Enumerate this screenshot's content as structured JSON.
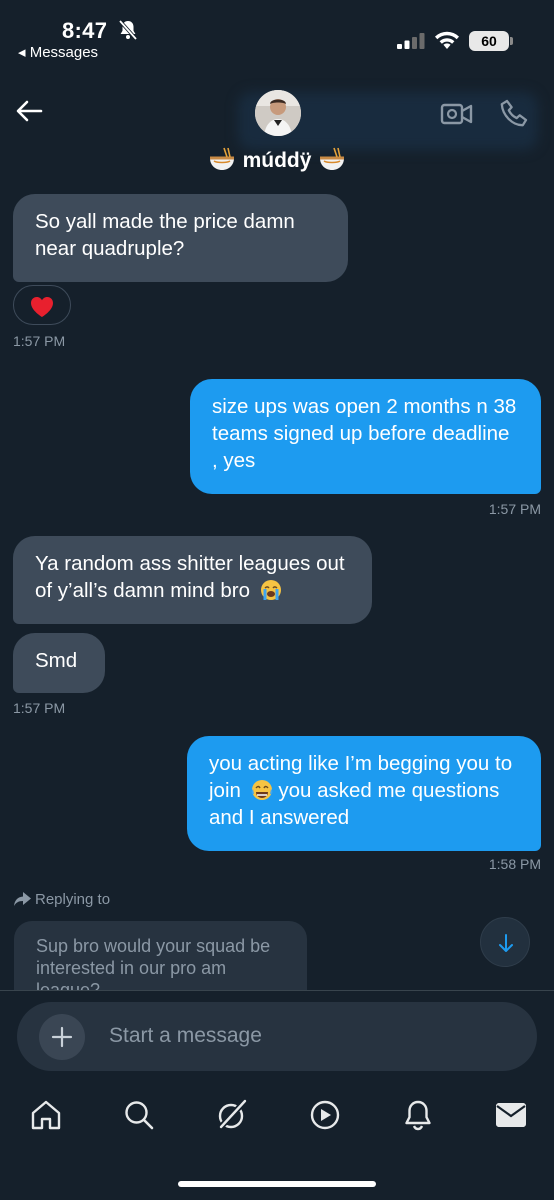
{
  "status_bar": {
    "time": "8:47",
    "back_app": "◂ Messages",
    "battery": "60"
  },
  "header": {
    "contact_name": "múddÿ"
  },
  "messages": [
    {
      "text": "So yall made the price damn near quadruple?",
      "direction": "incoming",
      "reaction": "red-heart"
    },
    {
      "text": "1:57 PM",
      "kind": "timestamp"
    },
    {
      "text": "size ups was open 2 months n 38 teams signed up before deadline , yes",
      "direction": "outgoing"
    },
    {
      "text": "1:57 PM",
      "kind": "timestamp"
    },
    {
      "text": "Ya random ass shitter leagues out of y’all’s damn mind bro",
      "direction": "incoming",
      "emoji": "loudly-crying-face"
    },
    {
      "text": "Smd",
      "direction": "incoming"
    },
    {
      "text": "1:57 PM",
      "kind": "timestamp"
    },
    {
      "text": "you acting like I’m begging you to join",
      "text_after_emoji": "you asked me questions and I answered",
      "direction": "outgoing",
      "emoji": "tears-of-joy-face"
    },
    {
      "text": "1:58 PM",
      "kind": "timestamp"
    }
  ],
  "reply": {
    "label": "Replying to",
    "preview": "Sup bro would your squad be interested in our pro am league?"
  },
  "composer": {
    "placeholder": "Start a message"
  },
  "nav": {
    "tabs": [
      "home-icon",
      "search-icon",
      "grok-icon",
      "video-play-icon",
      "notifications-icon",
      "messages-icon"
    ]
  },
  "colors": {
    "background": "#15202b",
    "incoming_bubble": "#3e4b5a",
    "outgoing_bubble": "#1d9bf0",
    "muted_text": "#8b98a5",
    "voice_accent": "#9b6cff"
  }
}
